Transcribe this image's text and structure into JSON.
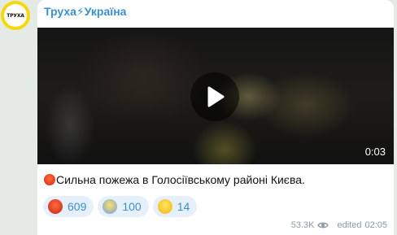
{
  "channel": {
    "avatar_text": "ТРУХА",
    "name": "Труха⚡Україна"
  },
  "video": {
    "duration": "0:03"
  },
  "message": {
    "text": "Сильна пожежа в Голосіївському районі Києва."
  },
  "reactions": [
    {
      "icon": "rage-face-icon",
      "count": "609"
    },
    {
      "icon": "screaming-face-icon",
      "count": "100"
    },
    {
      "icon": "confused-face-icon",
      "count": "14"
    }
  ],
  "meta": {
    "views": "53.3K",
    "edited_label": "edited",
    "time": "02:05"
  },
  "colors": {
    "accent": "#3a8fcf",
    "avatar_yellow": "#f6d80b",
    "reaction_bg": "#e6f0fb",
    "background": "#e4ebe6"
  }
}
